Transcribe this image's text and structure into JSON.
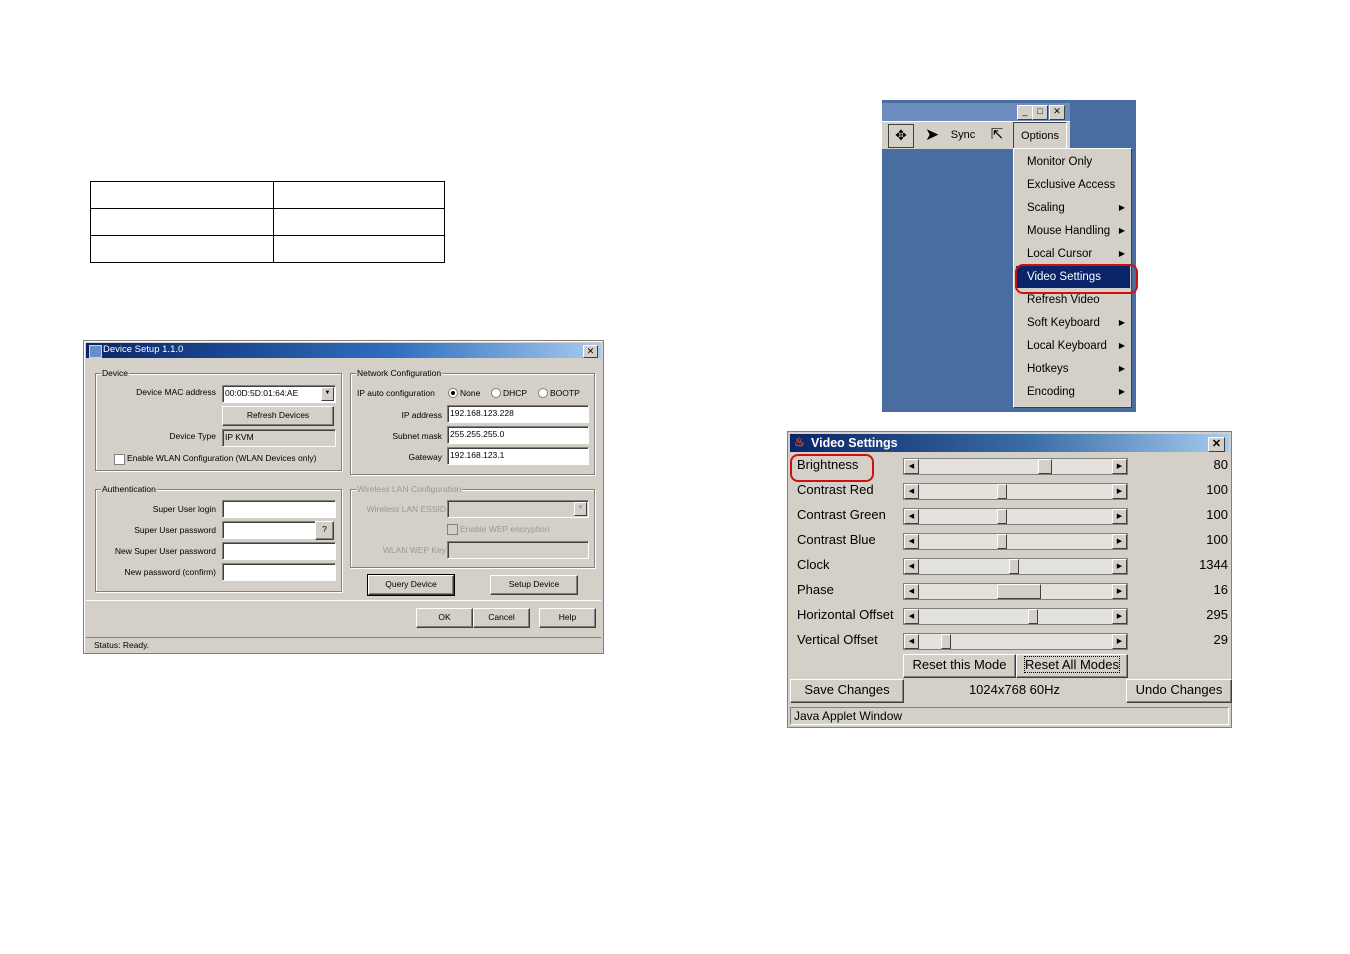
{
  "device_setup": {
    "title": "Device Setup 1.1.0",
    "device_group": {
      "label": "Device",
      "mac_label": "Device MAC address",
      "mac_value": "00:0D:5D:01:64:AE",
      "refresh_button": "Refresh Devices",
      "type_label": "Device Type",
      "type_value": "IP KVM",
      "wlan_checkbox": "Enable WLAN Configuration (WLAN Devices only)"
    },
    "network_group": {
      "label": "Network Configuration",
      "auto_label": "IP auto configuration",
      "radio_none": "None",
      "radio_dhcp": "DHCP",
      "radio_bootp": "BOOTP",
      "ip_label": "IP address",
      "ip_value": "192.168.123.228",
      "subnet_label": "Subnet mask",
      "subnet_value": "255.255.255.0",
      "gateway_label": "Gateway",
      "gateway_value": "192.168.123.1"
    },
    "auth_group": {
      "label": "Authentication",
      "login_label": "Super User login",
      "password_label": "Super User password",
      "password_help": "?",
      "new_password_label": "New Super User password",
      "confirm_label": "New password (confirm)"
    },
    "wlan_group": {
      "label": "Wireless LAN Configuration",
      "essid_label": "Wireless LAN ESSID",
      "wep_checkbox": "Enable WEP encryption",
      "wep_key_label": "WLAN WEP Key"
    },
    "buttons": {
      "query": "Query Device",
      "setup": "Setup Device",
      "ok": "OK",
      "cancel": "Cancel",
      "help": "Help"
    },
    "status": "Status: Ready."
  },
  "toolbar": {
    "sync_label": "Sync",
    "options_label": "Options"
  },
  "options_menu": {
    "items": [
      {
        "label": "Monitor Only",
        "submenu": false
      },
      {
        "label": "Exclusive Access",
        "submenu": false
      },
      {
        "label": "Scaling",
        "submenu": true
      },
      {
        "label": "Mouse Handling",
        "submenu": true
      },
      {
        "label": "Local Cursor",
        "submenu": true
      },
      {
        "label": "Video Settings",
        "submenu": false,
        "selected": true
      },
      {
        "label": "Refresh Video",
        "submenu": false
      },
      {
        "label": "Soft Keyboard",
        "submenu": true
      },
      {
        "label": "Local Keyboard",
        "submenu": true
      },
      {
        "label": "Hotkeys",
        "submenu": true
      },
      {
        "label": "Encoding",
        "submenu": true
      }
    ]
  },
  "video_settings": {
    "title": "Video Settings",
    "sliders": [
      {
        "label": "Brightness",
        "value": "80",
        "position": 0.62,
        "thumb": 0.06
      },
      {
        "label": "Contrast Red",
        "value": "100",
        "position": 0.41,
        "thumb": 0.04
      },
      {
        "label": "Contrast Green",
        "value": "100",
        "position": 0.41,
        "thumb": 0.04
      },
      {
        "label": "Contrast Blue",
        "value": "100",
        "position": 0.41,
        "thumb": 0.04
      },
      {
        "label": "Clock",
        "value": "1344",
        "position": 0.47,
        "thumb": 0.03
      },
      {
        "label": "Phase",
        "value": "16",
        "position": 0.41,
        "thumb": 0.22
      },
      {
        "label": "Horizontal Offset",
        "value": "295",
        "position": 0.57,
        "thumb": 0.04
      },
      {
        "label": "Vertical Offset",
        "value": "29",
        "position": 0.12,
        "thumb": 0.04
      }
    ],
    "reset_mode_button": "Reset this Mode",
    "reset_all_button": "Reset All Modes",
    "save_button": "Save Changes",
    "mode_label": "1024x768 60Hz",
    "undo_button": "Undo Changes",
    "applet_status": "Java Applet Window"
  },
  "colors": {
    "highlight_ring": "#d01010",
    "menu_selection": "#0a246a",
    "desktop": "#4a6da1"
  }
}
